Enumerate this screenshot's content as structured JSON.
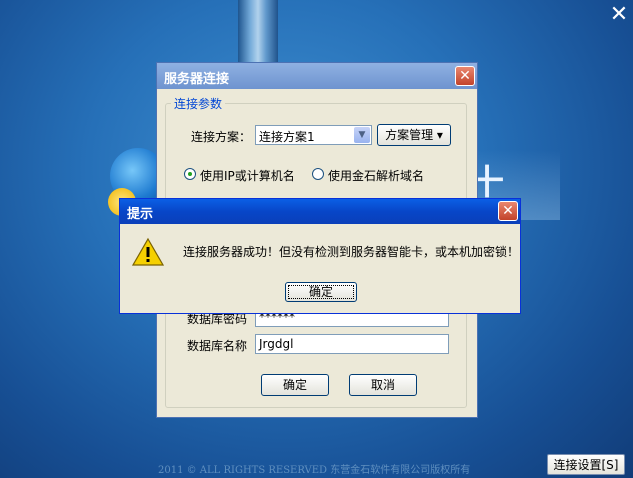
{
  "background": {
    "close_label": "✕",
    "copyright": "2011 ©  ALL RIGHTS RESERVED 东营金石软件有限公司版权所有",
    "settings_button": "连接设置[S]",
    "hidden_glyph": "十"
  },
  "server_dialog": {
    "title": "服务器连接",
    "close_label": "✕",
    "group_label": "连接参数",
    "scheme_label": "连接方案：",
    "scheme_value": "连接方案1",
    "scheme_manage_button": "方案管理 ▾",
    "radio_ip_label": "使用IP或计算机名",
    "radio_dns_label": "使用金石解析域名",
    "db_password_label": "数据库密码",
    "db_password_value": "******",
    "db_name_label": "数据库名称",
    "db_name_value": "Jrgdgl",
    "ok_button": "确定",
    "cancel_button": "取消"
  },
  "alert_dialog": {
    "title": "提示",
    "close_label": "✕",
    "message": "连接服务器成功！但没有检测到服务器智能卡，或本机加密锁！",
    "ok_button": "确定",
    "icon": "warning-icon"
  }
}
